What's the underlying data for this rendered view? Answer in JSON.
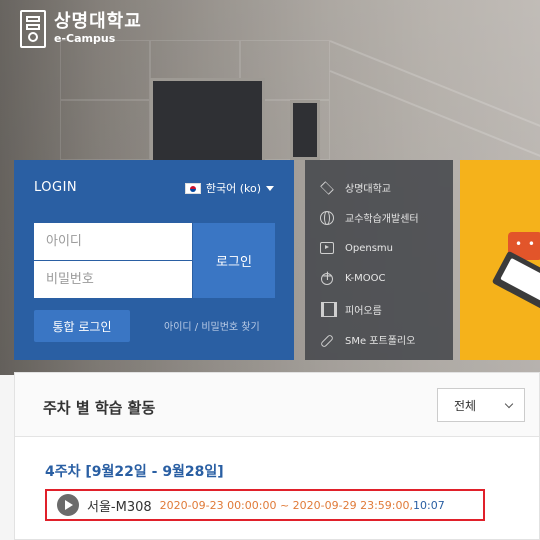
{
  "header": {
    "logo_title": "상명대학교",
    "logo_sub": "e-Campus"
  },
  "login": {
    "title": "LOGIN",
    "language": "한국어 (ko)",
    "id_placeholder": "아이디",
    "pw_placeholder": "비밀번호",
    "login_button": "로그인",
    "sso_button": "통합 로그인",
    "find_link": "아이디 / 비밀번호 찾기"
  },
  "quick_links": [
    {
      "label": "상명대학교",
      "icon": "layers-icon"
    },
    {
      "label": "교수학습개발센터",
      "icon": "globe-icon"
    },
    {
      "label": "Opensmu",
      "icon": "video-icon"
    },
    {
      "label": "K-MOOC",
      "icon": "move-icon"
    },
    {
      "label": "피어오름",
      "icon": "film-icon"
    },
    {
      "label": "SMe 포트폴리오",
      "icon": "link-icon"
    }
  ],
  "activity": {
    "title": "주차 별 학습 활동",
    "filter_value": "전체",
    "week_label": "4주차 [9월22일 - 9월28일]",
    "item": {
      "name": "서울-M308",
      "period": "2020-09-23 00:00:00 ~ 2020-09-29 23:59:00",
      "separator": ",",
      "duration": "10:07"
    }
  },
  "colors": {
    "login_bg": "#2a5fa3",
    "button_bg": "#3a76c4",
    "accent_orange": "#e07b39",
    "highlight_border": "#e0202a",
    "promo_yellow": "#f5b21b"
  }
}
